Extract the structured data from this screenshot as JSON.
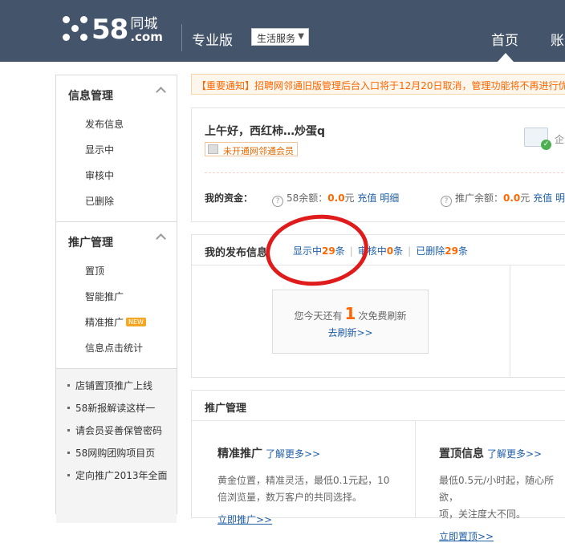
{
  "header": {
    "logo_num": "58",
    "logo_cn": "同城",
    "logo_com": ".com",
    "pro_label": "专业版",
    "service_select": "生活服务",
    "nav_home": "首页",
    "nav_account": "账"
  },
  "sidebar": {
    "groups": [
      {
        "title": "信息管理",
        "items": [
          "发布信息",
          "显示中",
          "审核中",
          "已删除"
        ]
      },
      {
        "title": "推广管理",
        "items": [
          "置顶",
          "智能推广",
          "精准推广",
          "信息点击统计"
        ],
        "new_badge": "NEW"
      }
    ],
    "news": [
      "店铺置顶推广上线",
      "58新报解读这样一",
      "请会员妥善保管密码",
      "58网购团购项目页",
      "定向推广2013年全面"
    ]
  },
  "notice": "【重要通知】招聘网邻通旧版管理后台入口将于12月20日取消，管理功能将不再进行优化",
  "account": {
    "greeting": "上午好，西红柿…炒蛋q",
    "member_status": "未开通网邻通会员",
    "enterprise_label": "企业",
    "funds_label": "我的资金：",
    "balance_58": {
      "label": "58余额：",
      "amount": "0.0",
      "unit": "元",
      "recharge": "充值",
      "detail": "明细"
    },
    "balance_promo": {
      "label": "推广余额：",
      "amount": "0.0",
      "unit": "元",
      "recharge": "充值",
      "detail": "明"
    }
  },
  "publish": {
    "title": "我的发布信息",
    "tabs": [
      {
        "label": "显示中",
        "count": "29",
        "suffix": "条"
      },
      {
        "label": "审核中",
        "count": "0",
        "suffix": "条"
      },
      {
        "label": "已删除",
        "count": "29",
        "suffix": "条"
      }
    ],
    "refresh_prefix": "您今天还有",
    "refresh_count": "1",
    "refresh_suffix": "次免费刷新",
    "refresh_link": "去刷新>>"
  },
  "promotion": {
    "title": "推广管理",
    "cards": [
      {
        "title": "精准推广",
        "more": "了解更多>>",
        "desc1": "黄金位置，精准灵活，最低0.1元起，10",
        "desc2": "倍浏览量，数万客户的共同选择。",
        "action": "立即推广>>"
      },
      {
        "title": "置顶信息",
        "more": "了解更多>>",
        "desc1": "最低0.5元/小时起，随心所欲，",
        "desc2": "项，关注度大不同。",
        "action": "立即置顶>>"
      }
    ]
  },
  "colors": {
    "header_bg": "#44546b",
    "accent_orange": "#ff6600",
    "link_blue": "#1f5fa8",
    "annotation_red": "#e01b1b"
  }
}
